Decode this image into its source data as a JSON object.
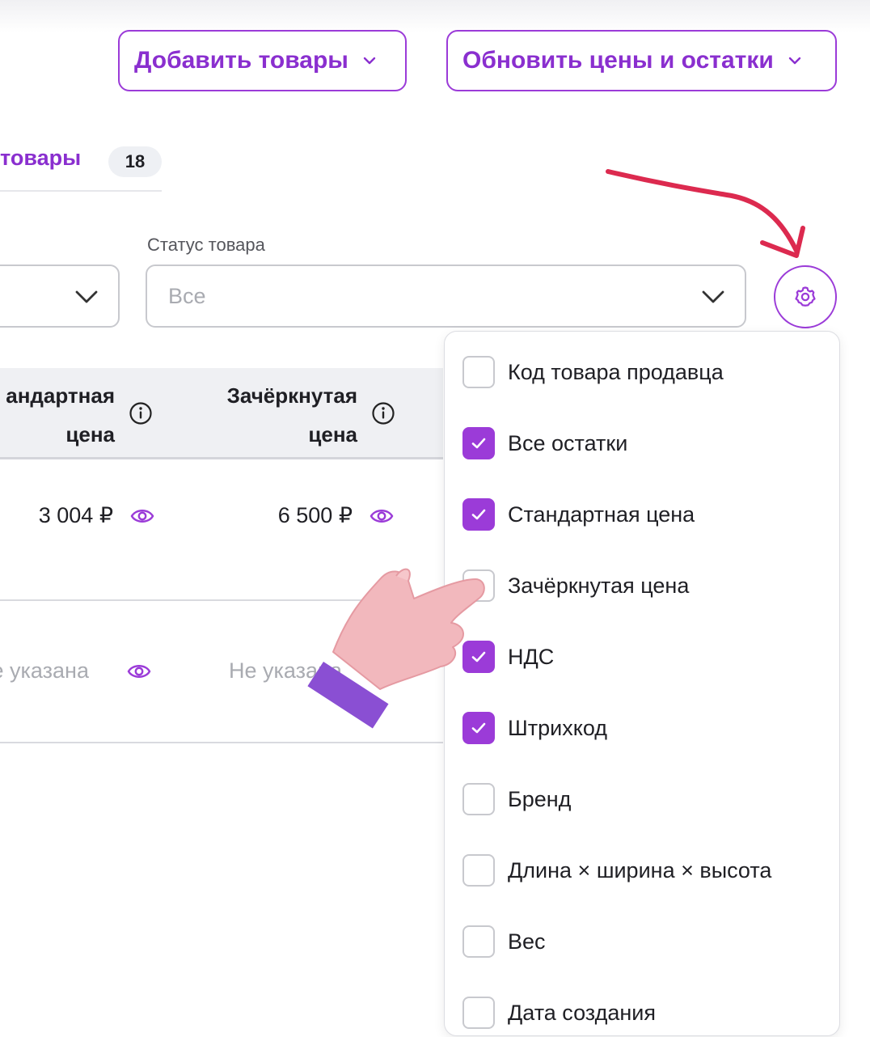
{
  "header": {
    "add_goods_label": "Добавить товары",
    "update_prices_label": "Обновить цены и остатки"
  },
  "tabs": [
    {
      "label": "товары",
      "count": "18"
    }
  ],
  "filters": {
    "status_label": "Статус товара",
    "status_value": "Все"
  },
  "table": {
    "columns": [
      {
        "line1": "андартная",
        "line2": "цена"
      },
      {
        "line1": "Зачёркнутая",
        "line2": "цена"
      }
    ],
    "rows": [
      {
        "standard_price": "3 004 ₽",
        "strike_price": "6 500 ₽"
      },
      {
        "standard_price": "Не указана",
        "strike_price": "Не указана"
      }
    ]
  },
  "column_menu": {
    "options": [
      {
        "label": "Код товара продавца",
        "checked": false
      },
      {
        "label": "Все остатки",
        "checked": true
      },
      {
        "label": "Стандартная цена",
        "checked": true
      },
      {
        "label": "Зачёркнутая цена",
        "checked": false
      },
      {
        "label": "НДС",
        "checked": true
      },
      {
        "label": "Штрихкод",
        "checked": true
      },
      {
        "label": "Бренд",
        "checked": false
      },
      {
        "label": "Длина × ширина × высота",
        "checked": false
      },
      {
        "label": "Вес",
        "checked": false
      },
      {
        "label": "Дата создания",
        "checked": false
      }
    ]
  },
  "icons": {
    "settings": "gear-icon",
    "column_info": "info-icon",
    "visibility": "eye-icon",
    "dropdown": "chevron-down-icon",
    "annotation": "red-arrow",
    "pointer": "pointing-hand"
  },
  "colors": {
    "accent": "#9b3bd8",
    "accent_text": "#8a2fcf",
    "arrow": "#dc2a4f",
    "header_bg": "#eff0f3",
    "muted_text": "#a9abb1"
  }
}
